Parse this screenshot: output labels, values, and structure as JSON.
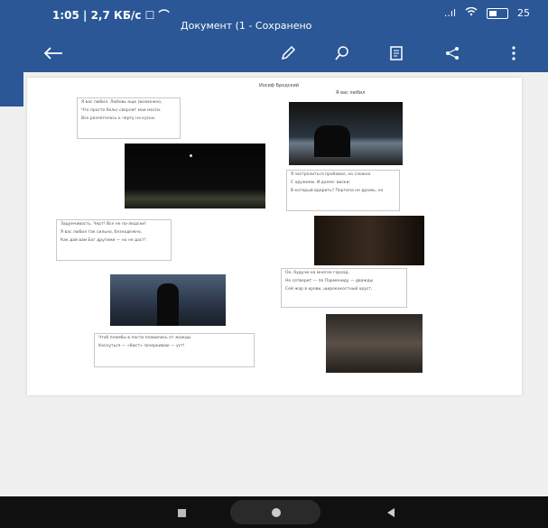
{
  "statusbar": {
    "time": "1:05 | 2,7 КБ/с ☐ ⌒",
    "signal": "..ıl",
    "battery": "25"
  },
  "document": {
    "title": "Документ (1 - Сохранено",
    "author": "Иосиф Бродский",
    "poem_title": "Я вас любил",
    "boxes": [
      [
        "Я вас любил. Любовь еще (возможно,",
        "Что просто боль) сверлит мои мозги.",
        "Все разлетелось к черту на куски."
      ],
      [
        "Я застрелиться пробовал, но сложно",
        "С оружием. И далее: виски:",
        "В который вдарить? Портила не дрожь, но"
      ],
      [
        "Задумчивость. Черт! Все не по-людски!",
        "Я вас любил так сильно, безнадежно,",
        "Как дай вам Бог другими — но не даст!"
      ],
      [
        "Он, будучи на многое горазд,",
        "Не сотворит — по Пармениду — дважды",
        "Сей жар в крови, ширококостный хруст,"
      ],
      [
        "Чтоб пломбы в пасти плавились от жажды",
        "Коснуться — «бюст» зачеркиваю — уст!"
      ]
    ]
  },
  "colors": {
    "header": "#2b5797",
    "navbar": "#101010"
  },
  "icons": [
    "back-arrow-icon",
    "pencil-icon",
    "search-icon",
    "book-icon",
    "share-icon",
    "more-icon",
    "square-icon",
    "home-icon",
    "back-triangle-icon"
  ]
}
